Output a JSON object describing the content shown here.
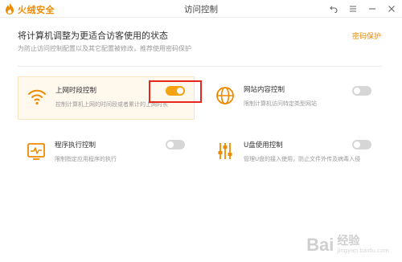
{
  "titlebar": {
    "app_name": "火绒安全",
    "window_title": "访问控制",
    "icons": [
      "undo-icon",
      "menu-icon",
      "minimize-icon",
      "close-icon"
    ]
  },
  "header": {
    "title": "将计算机调整为更适合访客使用的状态",
    "subtitle": "为防止访问控制配置以及其它配置被修改，推荐使用密码保护",
    "password_link": "密码保护"
  },
  "controls": [
    {
      "title": "上网时段控制",
      "desc": "控制计算机上网的时间段或者累计的上网时长",
      "enabled": true,
      "icon": "wifi-icon"
    },
    {
      "title": "网站内容控制",
      "desc": "限制计算机访问特定类型网站",
      "enabled": false,
      "icon": "globe-icon"
    },
    {
      "title": "程序执行控制",
      "desc": "限制指定应用程序的执行",
      "enabled": false,
      "icon": "monitor-pulse-icon"
    },
    {
      "title": "U盘使用控制",
      "desc": "管理U盘的接入使用，防止文件外传及病毒入侵",
      "enabled": false,
      "icon": "sliders-icon"
    }
  ],
  "colors": {
    "accent": "#f08a00",
    "toggle_on": "#f5a212",
    "highlight": "#e8261c"
  },
  "watermark": {
    "logo": "Bai",
    "cn": "经验",
    "url": "jingyan.baidu.com"
  }
}
